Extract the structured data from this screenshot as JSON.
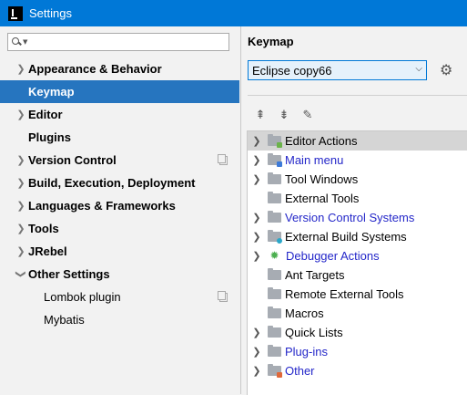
{
  "window": {
    "title": "Settings"
  },
  "search": {
    "placeholder": "",
    "value": ""
  },
  "sidebar": {
    "items": [
      {
        "label": "Appearance & Behavior",
        "expandable": true
      },
      {
        "label": "Keymap",
        "selected": true
      },
      {
        "label": "Editor",
        "expandable": true
      },
      {
        "label": "Plugins"
      },
      {
        "label": "Version Control",
        "expandable": true,
        "copy_icon": true
      },
      {
        "label": "Build, Execution, Deployment",
        "expandable": true
      },
      {
        "label": "Languages & Frameworks",
        "expandable": true
      },
      {
        "label": "Tools",
        "expandable": true
      },
      {
        "label": "JRebel",
        "expandable": true
      },
      {
        "label": "Other Settings",
        "expanded": true
      },
      {
        "label": "Lombok plugin",
        "child": true,
        "copy_icon": true
      },
      {
        "label": "Mybatis",
        "child": true
      }
    ]
  },
  "keymap": {
    "title": "Keymap",
    "selected_keymap": "Eclipse copy66",
    "toolbar": [
      "expand-all-icon",
      "collapse-all-icon",
      "edit-icon"
    ],
    "actions": [
      {
        "label": "Editor Actions",
        "expandable": true,
        "selected": true,
        "color": "#000000"
      },
      {
        "label": "Main menu",
        "expandable": true,
        "color": "#2427c9"
      },
      {
        "label": "Tool Windows",
        "expandable": true,
        "color": "#000000"
      },
      {
        "label": "External Tools",
        "color": "#000000"
      },
      {
        "label": "Version Control Systems",
        "expandable": true,
        "color": "#2427c9"
      },
      {
        "label": "External Build Systems",
        "expandable": true,
        "color": "#000000"
      },
      {
        "label": "Debugger Actions",
        "expandable": true,
        "color": "#2427c9",
        "icon": "bug-icon"
      },
      {
        "label": "Ant Targets",
        "color": "#000000"
      },
      {
        "label": "Remote External Tools",
        "color": "#000000"
      },
      {
        "label": "Macros",
        "color": "#000000"
      },
      {
        "label": "Quick Lists",
        "expandable": true,
        "color": "#000000"
      },
      {
        "label": "Plug-ins",
        "expandable": true,
        "color": "#2427c9"
      },
      {
        "label": "Other",
        "expandable": true,
        "color": "#2427c9"
      }
    ]
  },
  "colors": {
    "titlebar": "#0078d7",
    "selection": "#2675bf",
    "modified_text": "#2427c9"
  }
}
